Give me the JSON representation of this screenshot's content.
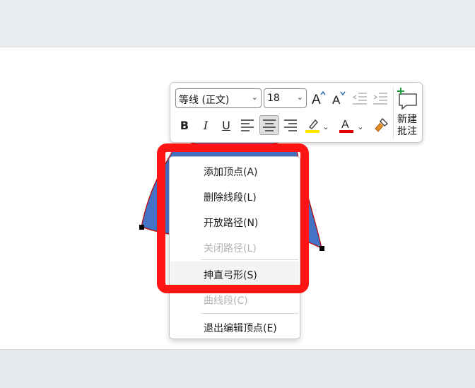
{
  "mini_toolbar": {
    "font_name": "等线 (正文)",
    "font_size": "18",
    "comment_line1": "新建",
    "comment_line2": "批注",
    "bold": "B",
    "italic": "I",
    "underline": "U",
    "font_color_letter": "A",
    "grow_font_letter": "A",
    "shrink_font_letter": "A",
    "colors": {
      "highlight": "#ffe600",
      "font_color": "#e00000",
      "brush": "#e08a20"
    }
  },
  "context_menu": {
    "items": [
      {
        "label": "添加顶点(A)",
        "disabled": false
      },
      {
        "label": "删除线段(L)",
        "disabled": false
      },
      {
        "label": "开放路径(N)",
        "disabled": false
      },
      {
        "label": "关闭路径(L)",
        "disabled": true
      },
      {
        "label": "抻直弓形(S)",
        "disabled": false
      },
      {
        "label": "曲线段(C)",
        "disabled": true
      },
      {
        "label": "退出编辑顶点(E)",
        "disabled": false
      }
    ]
  },
  "colors": {
    "shape_fill": "#4472c4",
    "shape_outline": "#c00000",
    "highlight_border": "#ff1414"
  }
}
